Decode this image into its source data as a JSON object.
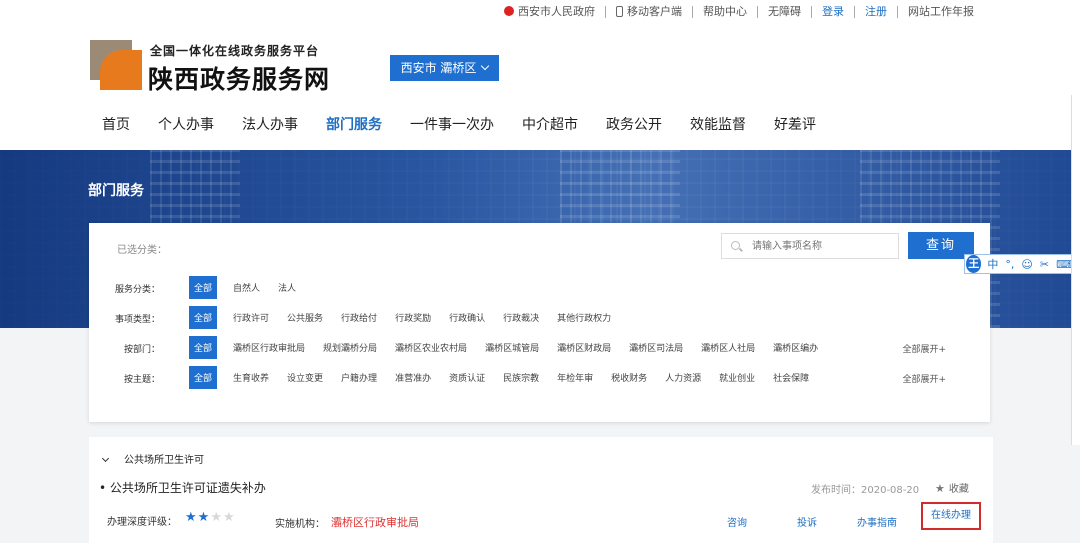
{
  "top_links": {
    "gov": "西安市人民政府",
    "mobile": "移动客户端",
    "help": "帮助中心",
    "access": "无障碍",
    "login": "登录",
    "register": "注册",
    "report": "网站工作年报"
  },
  "header": {
    "logo_sub": "全国一体化在线政务服务平台",
    "logo_main": "陕西政务服务网",
    "region": "西安市 灞桥区"
  },
  "nav": [
    "首页",
    "个人办事",
    "法人办事",
    "部门服务",
    "一件事一次办",
    "中介超市",
    "政务公开",
    "效能监督",
    "好差评"
  ],
  "nav_active": "部门服务",
  "banner": {
    "title": "部门服务"
  },
  "filter": {
    "selected_label": "已选分类：",
    "search_placeholder": "请输入事项名称",
    "search_button": "查询",
    "rows": [
      {
        "label": "服务分类：",
        "options": [
          "全部",
          "自然人",
          "法人"
        ],
        "more": ""
      },
      {
        "label": "事项类型：",
        "options": [
          "全部",
          "行政许可",
          "公共服务",
          "行政给付",
          "行政奖励",
          "行政确认",
          "行政裁决",
          "其他行政权力"
        ],
        "more": ""
      },
      {
        "label": "按部门：",
        "options": [
          "全部",
          "灞桥区行政审批局",
          "规划灞桥分局",
          "灞桥区农业农村局",
          "灞桥区城管局",
          "灞桥区财政局",
          "灞桥区司法局",
          "灞桥区人社局",
          "灞桥区编办"
        ],
        "more": "全部展开+"
      },
      {
        "label": "按主题：",
        "options": [
          "全部",
          "生育收养",
          "设立变更",
          "户籍办理",
          "准营准办",
          "资质认证",
          "民族宗教",
          "年检年审",
          "税收财务",
          "人力资源",
          "就业创业",
          "社会保障"
        ],
        "more": "全部展开+"
      }
    ]
  },
  "ime": {
    "logo": "王",
    "lang": "中"
  },
  "result": {
    "category": "公共场所卫生许可",
    "item_name": "• 公共场所卫生许可证遗失补办",
    "publish": "发布时间：2020-08-20",
    "favorite": "收藏",
    "depth_label": "办理深度评级：",
    "depth_rating": 2,
    "depth_max": 4,
    "org_label": "实施机构：",
    "org_value": "灞桥区行政审批局",
    "actions": {
      "consult": "咨询",
      "complain": "投诉",
      "guide": "办事指南",
      "online": "在线办理"
    }
  }
}
